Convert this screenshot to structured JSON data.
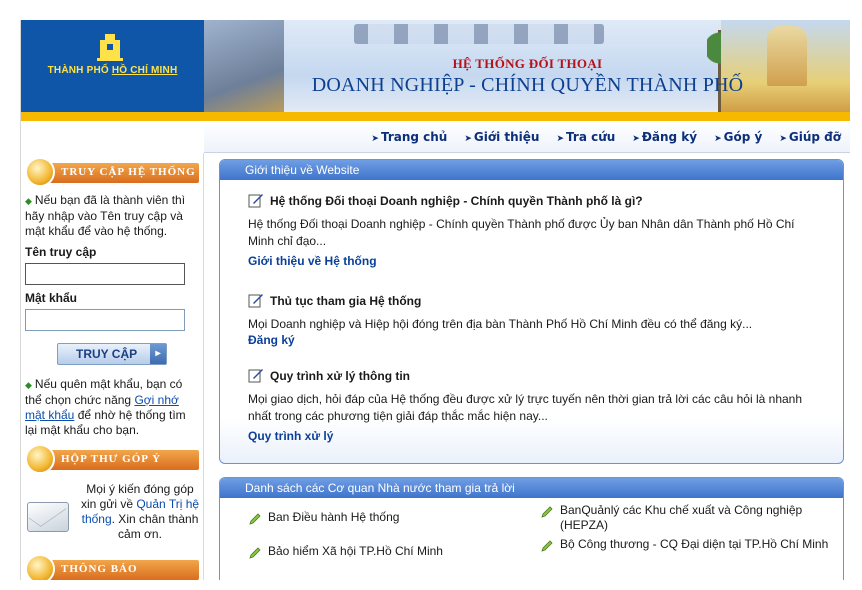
{
  "logo": {
    "line1": "THÀNH PHỐ",
    "line2": "HỒ CHÍ MINH"
  },
  "banner": {
    "title1": "HỆ THỐNG ĐỐI THOẠI",
    "title2": "DOANH NGHIỆP - CHÍNH QUYỀN THÀNH PHỐ"
  },
  "nav": {
    "items": [
      "Trang chủ",
      "Giới thiệu",
      "Tra cứu",
      "Đăng ký",
      "Góp ý",
      "Giúp đỡ"
    ]
  },
  "sidebar": {
    "access_title": "TRUY CẬP HỆ THỐNG",
    "intro_text": "Nếu bạn đã là thành viên thì hãy nhập vào Tên truy cập và mật khẩu để vào hệ thống.",
    "username_label": "Tên truy cập",
    "username_value": "",
    "password_label": "Mật khẩu",
    "password_value": "",
    "login_button": "TRUY CẬP",
    "forgot_pre": "Nếu quên mật khẩu, bạn có thể chọn chức năng",
    "forgot_link": "Gợi nhớ mật khẩu",
    "forgot_post": "để nhờ hệ thống tìm lại mật khẩu cho bạn.",
    "mailbox_title": "HỘP THƯ GÓP Ý",
    "mailbox_pre": "Mọi ý kiến đóng góp xin gửi về",
    "mailbox_link": "Quản Trị hệ thống",
    "mailbox_post": ". Xin chân thành cảm ơn.",
    "notice_title": "THÔNG BÁO"
  },
  "intro_panel": {
    "title": "Giới thiệu về Website",
    "items": [
      {
        "title": "Hệ thống Đối thoại Doanh nghiệp - Chính quyền Thành phố là gì?",
        "desc": "Hệ thống Đối thoại Doanh nghiệp - Chính quyền Thành phố được Ủy ban Nhân dân Thành phố Hồ Chí Minh chỉ đạo...",
        "link": "Giới thiệu về Hệ thống"
      },
      {
        "title": "Thủ tục tham gia Hệ thống",
        "desc": "Mọi Doanh nghiệp và Hiệp hội đóng trên địa bàn Thành Phố Hồ Chí Minh đều có thể đăng ký...",
        "link": "Đăng ký"
      },
      {
        "title": "Quy trình xử lý thông tin",
        "desc": "Mọi giao dịch, hỏi đáp của Hệ thống đều được xử lý trực tuyến nên thời gian trả lời các câu hỏi là nhanh nhất trong các phương tiện giải đáp thắc mắc hiện nay...",
        "link": "Quy trình xử lý"
      }
    ]
  },
  "agencies_panel": {
    "title": "Danh sách các Cơ quan Nhà nước tham gia trả lời",
    "items": [
      "Ban Điều hành Hệ thống",
      "BanQuảnlý các Khu chế xuất và Công nghiệp (HEPZA)",
      "Bảo hiểm Xã hội TP.Hồ Chí Minh",
      "Bộ Công thương - CQ Đại diện tại TP.Hồ Chí Minh"
    ]
  },
  "colors": {
    "brand_blue": "#0f56a8",
    "accent_yellow": "#f6b900",
    "nav_text": "#0d2f7a",
    "panel_head": "#4a7fd0",
    "side_head": "#e0802c"
  }
}
